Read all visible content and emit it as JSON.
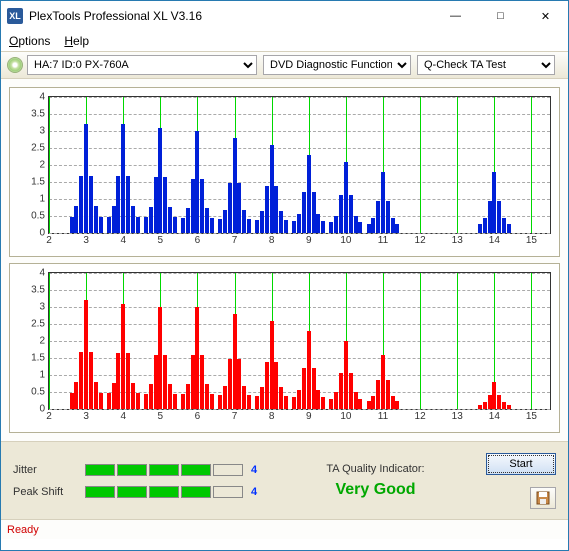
{
  "window": {
    "title": "PlexTools Professional XL V3.16",
    "minimize": "—",
    "maximize": "□",
    "close": "✕"
  },
  "menu": {
    "options": "Options",
    "help": "Help"
  },
  "toolbar": {
    "device": "HA:7 ID:0   PX-760A",
    "func": "DVD Diagnostic Functions",
    "test": "Q-Check TA Test"
  },
  "chart_data": [
    {
      "type": "bar",
      "color": "#0020d8",
      "ylim": [
        0,
        4
      ],
      "yticks": [
        0,
        0.5,
        1,
        1.5,
        2,
        2.5,
        3,
        3.5,
        4
      ],
      "xticks": [
        2,
        3,
        4,
        5,
        6,
        7,
        8,
        9,
        10,
        11,
        12,
        13,
        14,
        15
      ],
      "peaks": [
        {
          "x": 3,
          "h": 3.2
        },
        {
          "x": 4,
          "h": 3.2
        },
        {
          "x": 5,
          "h": 3.1
        },
        {
          "x": 6,
          "h": 3.0
        },
        {
          "x": 7,
          "h": 2.8
        },
        {
          "x": 8,
          "h": 2.6
        },
        {
          "x": 9,
          "h": 2.3
        },
        {
          "x": 10,
          "h": 2.1
        },
        {
          "x": 11,
          "h": 1.8
        },
        {
          "x": 14,
          "h": 1.8
        }
      ]
    },
    {
      "type": "bar",
      "color": "#ff0000",
      "ylim": [
        0,
        4
      ],
      "yticks": [
        0,
        0.5,
        1,
        1.5,
        2,
        2.5,
        3,
        3.5,
        4
      ],
      "xticks": [
        2,
        3,
        4,
        5,
        6,
        7,
        8,
        9,
        10,
        11,
        12,
        13,
        14,
        15
      ],
      "peaks": [
        {
          "x": 3,
          "h": 3.2
        },
        {
          "x": 4,
          "h": 3.1
        },
        {
          "x": 5,
          "h": 3.0
        },
        {
          "x": 6,
          "h": 3.0
        },
        {
          "x": 7,
          "h": 2.8
        },
        {
          "x": 8,
          "h": 2.6
        },
        {
          "x": 9,
          "h": 2.3
        },
        {
          "x": 10,
          "h": 2.0
        },
        {
          "x": 11,
          "h": 1.6
        },
        {
          "x": 14,
          "h": 0.8
        }
      ]
    }
  ],
  "meters": {
    "jitter": {
      "label": "Jitter",
      "filled": 4,
      "total": 5,
      "value": "4"
    },
    "peakshift": {
      "label": "Peak Shift",
      "filled": 4,
      "total": 5,
      "value": "4"
    }
  },
  "ta": {
    "label": "TA Quality Indicator:",
    "value": "Very Good"
  },
  "buttons": {
    "start": "Start"
  },
  "status": "Ready"
}
